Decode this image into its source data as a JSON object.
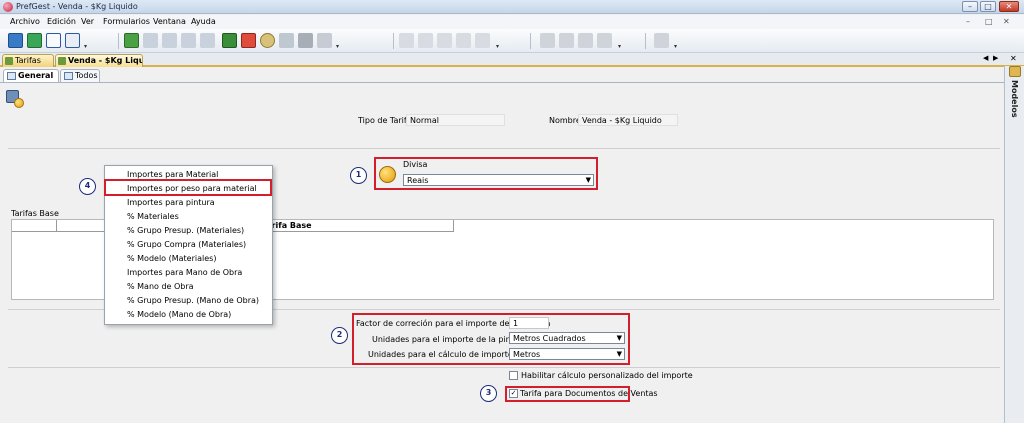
{
  "window": {
    "title": "PrefGest - Venda - $Kg Liquido"
  },
  "menubar": {
    "items": [
      "Archivo",
      "Edición",
      "Ver",
      "Formularios",
      "Ventana",
      "Ayuda"
    ]
  },
  "doctabs": {
    "items": [
      {
        "label": "Tarifas"
      },
      {
        "label": "Venda - $Kg Liquido"
      }
    ]
  },
  "innertabs": {
    "items": [
      {
        "label": "General"
      },
      {
        "label": "Todos"
      }
    ]
  },
  "sidebar": {
    "label": "Modelos"
  },
  "header": {
    "tipo_label": "Tipo de Tarifa",
    "tipo_value": "Normal",
    "nombre_label": "Nombre",
    "nombre_value": "Venda - $Kg Liquido"
  },
  "divisa": {
    "label": "Divisa",
    "value": "Reais"
  },
  "tarifas_base": {
    "label": "Tarifas Base",
    "column": "Nombre de la Tarifa Base"
  },
  "popup": {
    "items": [
      "Importes para Material",
      "Importes por peso para material",
      "Importes para pintura",
      "% Materiales",
      "% Grupo Presup. (Materiales)",
      "% Grupo Compra (Materiales)",
      "% Modelo (Materiales)",
      "Importes para Mano de Obra",
      "% Mano de Obra",
      "% Grupo Presup. (Mano de Obra)",
      "% Modelo (Mano de Obra)"
    ]
  },
  "pintura": {
    "factor_label": "Factor de correción para el importe de la pintura",
    "factor_value": "1",
    "unidades_label": "Unidades para el importe de la pintura",
    "unidades_value": "Metros Cuadrados",
    "lineales_label": "Unidades para el cálculo de importes lineales",
    "lineales_value": "Metros"
  },
  "checks": {
    "habilitar_label": "Habilitar cálculo personalizado del importe",
    "habilitar_checked": false,
    "documentos_label": "Tarifa para Documentos de Ventas",
    "documentos_checked": true
  },
  "callouts": {
    "c1": "1",
    "c2": "2",
    "c3": "3",
    "c4": "4"
  },
  "colors": {
    "annotation_red": "#d21f2b",
    "annotation_circle": "#1d2c7a",
    "tab_gold": "#f2d27a"
  }
}
